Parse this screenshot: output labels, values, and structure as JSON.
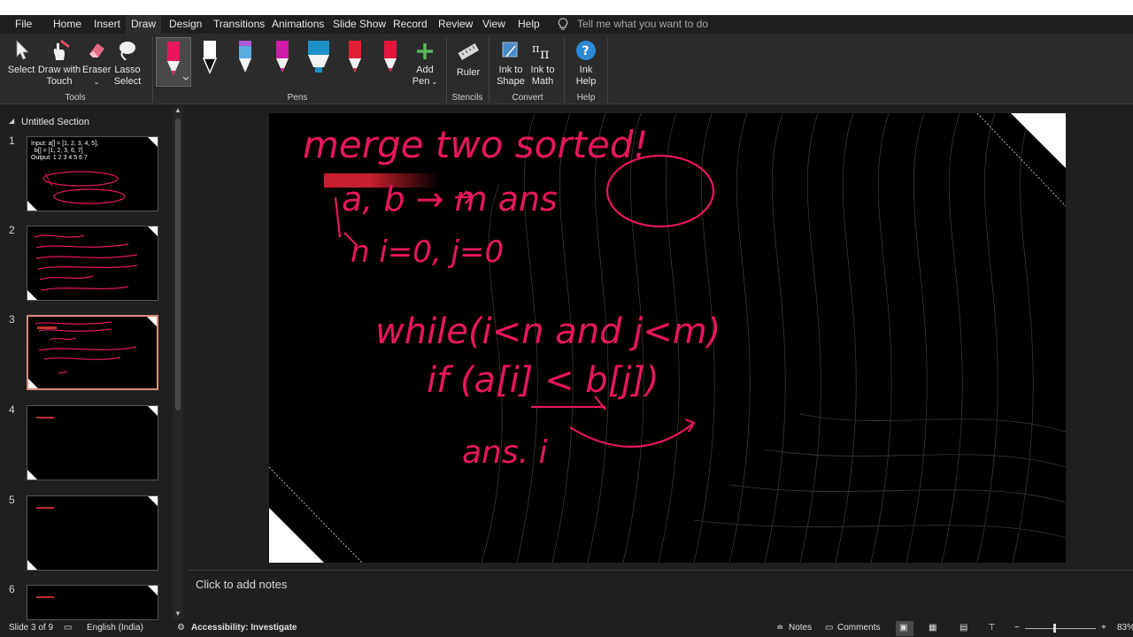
{
  "menu": {
    "tabs": [
      "File",
      "Home",
      "Insert",
      "Draw",
      "Design",
      "Transitions",
      "Animations",
      "Slide Show",
      "Record",
      "Review",
      "View",
      "Help"
    ],
    "active_tab": "Draw",
    "tell_me": "Tell me what you want to do"
  },
  "ribbon": {
    "tools": {
      "select": "Select",
      "draw_touch_1": "Draw with",
      "draw_touch_2": "Touch",
      "eraser": "Eraser",
      "lasso_1": "Lasso",
      "lasso_2": "Select",
      "group": "Tools"
    },
    "pens": {
      "add_1": "Add",
      "add_2": "Pen",
      "group": "Pens",
      "colors": [
        "#e8175d",
        "#ffffff",
        "#4fa3d9",
        "#d11aa8",
        "#1e90c8",
        "#e02030",
        "#e3173e"
      ]
    },
    "stencils": {
      "ruler": "Ruler",
      "group": "Stencils"
    },
    "convert": {
      "shape_1": "Ink to",
      "shape_2": "Shape",
      "math_1": "Ink to",
      "math_2": "Math",
      "group": "Convert"
    },
    "help": {
      "ink_1": "Ink",
      "ink_2": "Help",
      "group": "Help"
    }
  },
  "sidebar": {
    "section": "Untitled Section",
    "slides": [
      {
        "num": "1",
        "text": "Input: a[] = [1, 2, 3, 4, 5],\n  b[] = [1, 2, 3, 6, 7]\nOutput: 1 2 3 4 5 6 7"
      },
      {
        "num": "2",
        "text": ""
      },
      {
        "num": "3",
        "text": ""
      },
      {
        "num": "4",
        "text": ""
      },
      {
        "num": "5",
        "text": ""
      },
      {
        "num": "6",
        "text": ""
      }
    ]
  },
  "notes": {
    "placeholder": "Click to add notes"
  },
  "status": {
    "slide": "Slide 3 of 9",
    "language": "English (India)",
    "accessibility": "Accessibility: Investigate",
    "notes": "Notes",
    "comments": "Comments",
    "zoom": "83%"
  },
  "accent": "#e8175d",
  "slide_ink": {
    "line1": "merge two sorted!",
    "line2": "a, b → m   ans",
    "line3": "n   i=0, j=0",
    "line4": "while(i<n and j<m)",
    "line5": "if (a[i] < b[j])",
    "line6": "ans. i"
  }
}
